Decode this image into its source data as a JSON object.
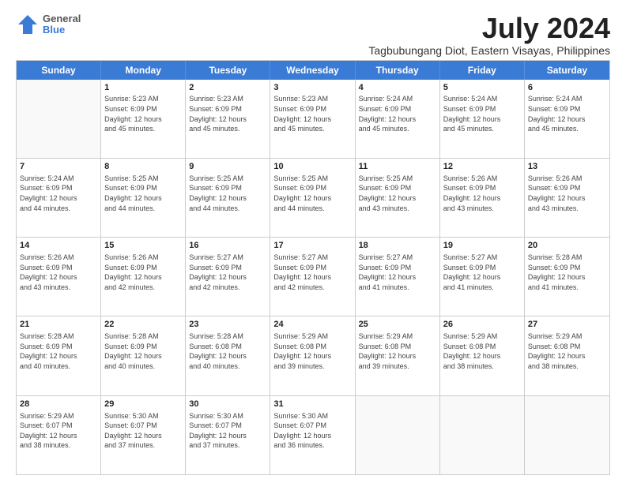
{
  "logo": {
    "line1": "General",
    "line2": "Blue"
  },
  "title": "July 2024",
  "subtitle": "Tagbubungang Diot, Eastern Visayas, Philippines",
  "header_days": [
    "Sunday",
    "Monday",
    "Tuesday",
    "Wednesday",
    "Thursday",
    "Friday",
    "Saturday"
  ],
  "weeks": [
    [
      {
        "day": "",
        "text": ""
      },
      {
        "day": "1",
        "text": "Sunrise: 5:23 AM\nSunset: 6:09 PM\nDaylight: 12 hours\nand 45 minutes."
      },
      {
        "day": "2",
        "text": "Sunrise: 5:23 AM\nSunset: 6:09 PM\nDaylight: 12 hours\nand 45 minutes."
      },
      {
        "day": "3",
        "text": "Sunrise: 5:23 AM\nSunset: 6:09 PM\nDaylight: 12 hours\nand 45 minutes."
      },
      {
        "day": "4",
        "text": "Sunrise: 5:24 AM\nSunset: 6:09 PM\nDaylight: 12 hours\nand 45 minutes."
      },
      {
        "day": "5",
        "text": "Sunrise: 5:24 AM\nSunset: 6:09 PM\nDaylight: 12 hours\nand 45 minutes."
      },
      {
        "day": "6",
        "text": "Sunrise: 5:24 AM\nSunset: 6:09 PM\nDaylight: 12 hours\nand 45 minutes."
      }
    ],
    [
      {
        "day": "7",
        "text": "Sunrise: 5:24 AM\nSunset: 6:09 PM\nDaylight: 12 hours\nand 44 minutes."
      },
      {
        "day": "8",
        "text": "Sunrise: 5:25 AM\nSunset: 6:09 PM\nDaylight: 12 hours\nand 44 minutes."
      },
      {
        "day": "9",
        "text": "Sunrise: 5:25 AM\nSunset: 6:09 PM\nDaylight: 12 hours\nand 44 minutes."
      },
      {
        "day": "10",
        "text": "Sunrise: 5:25 AM\nSunset: 6:09 PM\nDaylight: 12 hours\nand 44 minutes."
      },
      {
        "day": "11",
        "text": "Sunrise: 5:25 AM\nSunset: 6:09 PM\nDaylight: 12 hours\nand 43 minutes."
      },
      {
        "day": "12",
        "text": "Sunrise: 5:26 AM\nSunset: 6:09 PM\nDaylight: 12 hours\nand 43 minutes."
      },
      {
        "day": "13",
        "text": "Sunrise: 5:26 AM\nSunset: 6:09 PM\nDaylight: 12 hours\nand 43 minutes."
      }
    ],
    [
      {
        "day": "14",
        "text": "Sunrise: 5:26 AM\nSunset: 6:09 PM\nDaylight: 12 hours\nand 43 minutes."
      },
      {
        "day": "15",
        "text": "Sunrise: 5:26 AM\nSunset: 6:09 PM\nDaylight: 12 hours\nand 42 minutes."
      },
      {
        "day": "16",
        "text": "Sunrise: 5:27 AM\nSunset: 6:09 PM\nDaylight: 12 hours\nand 42 minutes."
      },
      {
        "day": "17",
        "text": "Sunrise: 5:27 AM\nSunset: 6:09 PM\nDaylight: 12 hours\nand 42 minutes."
      },
      {
        "day": "18",
        "text": "Sunrise: 5:27 AM\nSunset: 6:09 PM\nDaylight: 12 hours\nand 41 minutes."
      },
      {
        "day": "19",
        "text": "Sunrise: 5:27 AM\nSunset: 6:09 PM\nDaylight: 12 hours\nand 41 minutes."
      },
      {
        "day": "20",
        "text": "Sunrise: 5:28 AM\nSunset: 6:09 PM\nDaylight: 12 hours\nand 41 minutes."
      }
    ],
    [
      {
        "day": "21",
        "text": "Sunrise: 5:28 AM\nSunset: 6:09 PM\nDaylight: 12 hours\nand 40 minutes."
      },
      {
        "day": "22",
        "text": "Sunrise: 5:28 AM\nSunset: 6:09 PM\nDaylight: 12 hours\nand 40 minutes."
      },
      {
        "day": "23",
        "text": "Sunrise: 5:28 AM\nSunset: 6:08 PM\nDaylight: 12 hours\nand 40 minutes."
      },
      {
        "day": "24",
        "text": "Sunrise: 5:29 AM\nSunset: 6:08 PM\nDaylight: 12 hours\nand 39 minutes."
      },
      {
        "day": "25",
        "text": "Sunrise: 5:29 AM\nSunset: 6:08 PM\nDaylight: 12 hours\nand 39 minutes."
      },
      {
        "day": "26",
        "text": "Sunrise: 5:29 AM\nSunset: 6:08 PM\nDaylight: 12 hours\nand 38 minutes."
      },
      {
        "day": "27",
        "text": "Sunrise: 5:29 AM\nSunset: 6:08 PM\nDaylight: 12 hours\nand 38 minutes."
      }
    ],
    [
      {
        "day": "28",
        "text": "Sunrise: 5:29 AM\nSunset: 6:07 PM\nDaylight: 12 hours\nand 38 minutes."
      },
      {
        "day": "29",
        "text": "Sunrise: 5:30 AM\nSunset: 6:07 PM\nDaylight: 12 hours\nand 37 minutes."
      },
      {
        "day": "30",
        "text": "Sunrise: 5:30 AM\nSunset: 6:07 PM\nDaylight: 12 hours\nand 37 minutes."
      },
      {
        "day": "31",
        "text": "Sunrise: 5:30 AM\nSunset: 6:07 PM\nDaylight: 12 hours\nand 36 minutes."
      },
      {
        "day": "",
        "text": ""
      },
      {
        "day": "",
        "text": ""
      },
      {
        "day": "",
        "text": ""
      }
    ]
  ]
}
